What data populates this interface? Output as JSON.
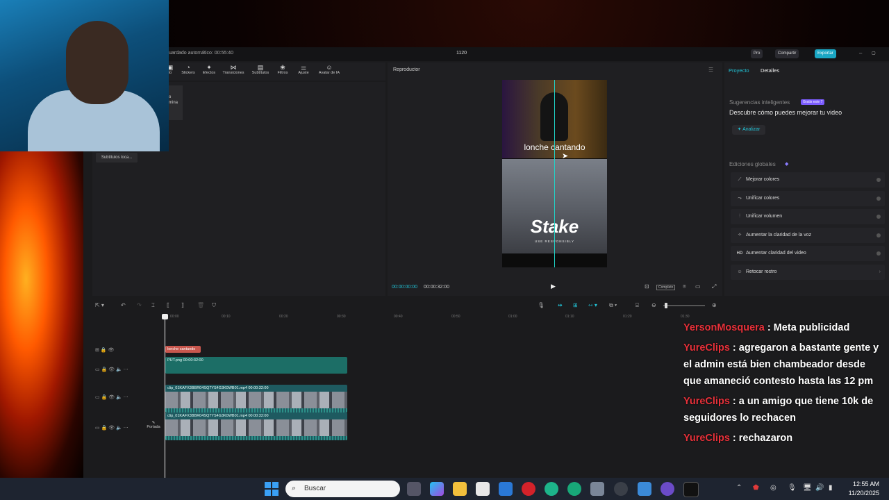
{
  "window": {
    "autosave": "uardado automático: 00:55:40",
    "project_name": "1120",
    "pro_label": "Pro",
    "share_label": "Compartir",
    "export_label": "Exportar"
  },
  "toolbar": {
    "items": [
      {
        "label": "to",
        "icon": "media-icon"
      },
      {
        "label": "Stickers",
        "icon": "sticker-icon"
      },
      {
        "label": "Efectos",
        "icon": "effects-icon"
      },
      {
        "label": "Transiciones",
        "icon": "transitions-icon"
      },
      {
        "label": "Subtítulos",
        "icon": "subtitles-icon"
      },
      {
        "label": "Filtros",
        "icon": "filters-icon"
      },
      {
        "label": "Ajuste",
        "icon": "adjust-icon"
      },
      {
        "label": "Avatar de IA",
        "icon": "avatar-icon"
      }
    ]
  },
  "left_pane": {
    "mini_card_line1": "o",
    "mini_card_line2": "mina",
    "subtitles_chip": "Subtítulos loca..."
  },
  "player": {
    "title": "Reproductor",
    "caption": "lonche cantando",
    "stake_logo": "Stake",
    "stake_sub": "USE RESPONSIBLY",
    "time_current": "00:00:00:00",
    "time_total": "00:00:32:00",
    "ratio_label": "Completo"
  },
  "right_panel": {
    "tab_project": "Proyecto",
    "tab_details": "Detalles",
    "smart_title": "Sugerencias inteligentes",
    "smart_badge": "Gratis este 7",
    "smart_desc": "Descubre cómo puedes mejorar tu video",
    "analyze_label": "Analizar",
    "global_title": "Ediciones globales",
    "global_items": [
      {
        "label": "Mejorar colores",
        "icon": "color-enhance-icon"
      },
      {
        "label": "Unificar colores",
        "icon": "color-unify-icon"
      },
      {
        "label": "Unificar volumen",
        "icon": "volume-unify-icon"
      },
      {
        "label": "Aumentar la claridad de la voz",
        "icon": "voice-clarity-icon"
      },
      {
        "label": "Aumentar claridad del video",
        "icon": "hd-icon"
      },
      {
        "label": "Retocar rostro",
        "icon": "face-retouch-icon"
      }
    ]
  },
  "timeline": {
    "ruler": [
      "00:00",
      "00:10",
      "00:20",
      "00:30",
      "00:40",
      "00:50",
      "01:00",
      "01:10",
      "01:20",
      "01:30"
    ],
    "text_clip": "lonche cantando",
    "png_clip": "PUT.png  00:00:32:00",
    "video_clip_1": "clip_01KAFX3BBR04SQ7YS4G3K0WB01.mp4  00:00:32:00",
    "video_clip_2": "clip_01KAFX3BBR04SQ7YS4G3K0WB01.mp4  00:00:32:00",
    "cover_label": "Portada"
  },
  "chat": [
    {
      "user": "YersonMosquera",
      "text": ": Meta publicidad"
    },
    {
      "user": "YureClips",
      "text": ": agregaron a bastante gente y el admin está bien chambeador desde que amaneció contesto hasta las 12 pm"
    },
    {
      "user": "YureClips",
      "text": ": a un amigo que tiene 10k de seguidores lo rechacen"
    },
    {
      "user": "YureClips",
      "text": ": rechazaron"
    }
  ],
  "taskbar": {
    "search_placeholder": "Buscar",
    "time": "12:55 AM",
    "date": "11/20/2025"
  }
}
